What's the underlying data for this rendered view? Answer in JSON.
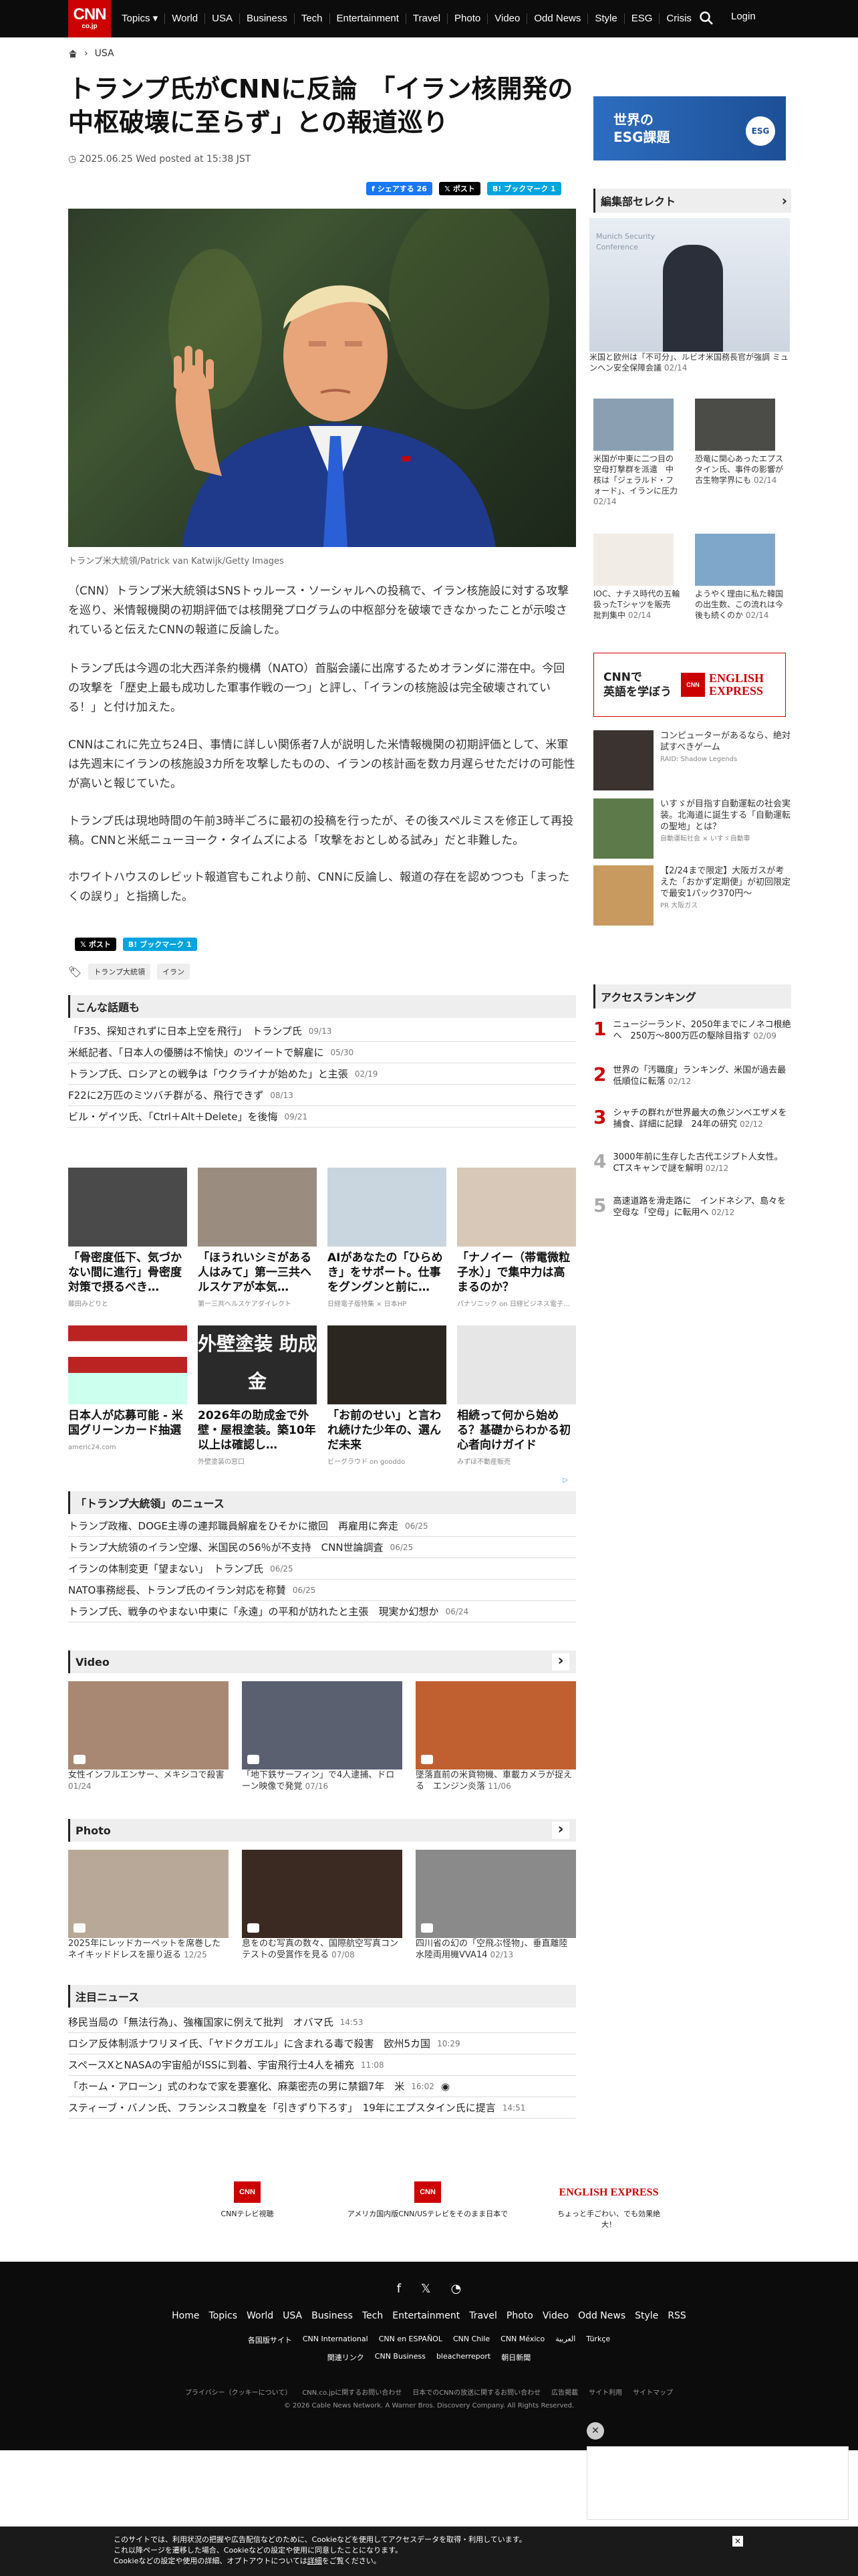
{
  "nav": {
    "logo_main": "CNN",
    "logo_sub": "co.jp",
    "items": [
      "Topics ▾",
      "World",
      "USA",
      "Business",
      "Tech",
      "Entertainment",
      "Travel",
      "Photo",
      "Video",
      "Odd News",
      "Style",
      "ESG",
      "Crisis"
    ],
    "login": "Login"
  },
  "breadcrumb": {
    "section": "USA"
  },
  "article": {
    "title": "トランプ氏がCNNに反論　「イラン核開発の中枢破壊に至らず」との報道巡り",
    "date": "2025.06.25 Wed posted at 15:38 JST",
    "share": {
      "facebook": "シェアする 26",
      "x": "ポスト",
      "hatena": "ブックマーク 1"
    },
    "caption": "トランプ米大統領/Patrick van Katwijk/Getty Images",
    "paragraphs": [
      "（CNN）トランプ米大統領はSNSトゥルース・ソーシャルへの投稿で、イラン核施設に対する攻撃を巡り、米情報機関の初期評価では核開発プログラムの中枢部分を破壊できなかったことが示唆されていると伝えたCNNの報道に反論した。",
      "トランプ氏は今週の北大西洋条約機構（NATO）首脳会議に出席するためオランダに滞在中。今回の攻撃を「歴史上最も成功した軍事作戦の一つ」と評し、「イランの核施設は完全破壊されている！」と付け加えた。",
      "CNNはこれに先立ち24日、事情に詳しい関係者7人が説明した米情報機関の初期評価として、米軍は先週末にイランの核施設3カ所を攻撃したものの、イランの核計画を数カ月遅らせただけの可能性が高いと報じていた。",
      "トランプ氏は現地時間の午前3時半ごろに最初の投稿を行ったが、その後スペルミスを修正して再投稿。CNNと米紙ニューヨーク・タイムズによる「攻撃をおとしめる試み」だと非難した。",
      "ホワイトハウスのレビット報道官もこれより前、CNNに反論し、報道の存在を認めつつも「まったくの誤り」と指摘した。"
    ],
    "bottom_share": {
      "x": "ポスト",
      "hatena": "ブックマーク 1"
    },
    "tags": [
      "トランプ大統領",
      "イラン"
    ]
  },
  "related": {
    "title": "こんな話題も",
    "items": [
      {
        "text": "「F35、探知されずに日本上空を飛行」　トランプ氏",
        "date": "09/13"
      },
      {
        "text": "米紙記者、「日本人の優勝は不愉快」のツイートで解雇に",
        "date": "05/30"
      },
      {
        "text": "トランプ氏、ロシアとの戦争は「ウクライナが始めた」と主張",
        "date": "02/19"
      },
      {
        "text": "F22に2万匹のミツバチ群がる、飛行できず",
        "date": "08/13"
      },
      {
        "text": "ビル・ゲイツ氏、「Ctrl＋Alt＋Delete」を後悔",
        "date": "09/21"
      }
    ]
  },
  "ads": [
    {
      "title": "「骨密度低下、気づかない間に進行」骨密度対策で摂るべき…",
      "src": "藤田みどりと"
    },
    {
      "title": "「ほうれいシミがある人はみて」第一三共ヘルスケアが本気…",
      "src": "第一三共ヘルスケアダイレクト"
    },
    {
      "title": "AIがあなたの「ひらめき」をサポート。仕事をグングンと前に…",
      "src": "日経電子版特集 × 日本HP"
    },
    {
      "title": "「ナノイー（帯電微粒子水）」で集中力は高まるのか？",
      "src": "パナソニック on 日経ビジネス電子…"
    },
    {
      "title": "日本人が応募可能 - 米国グリーンカード抽選",
      "src": "americ24.com"
    },
    {
      "title": "2026年の助成金で外壁・屋根塗装。築10年以上は確認し…",
      "src": "外壁塗装の窓口"
    },
    {
      "title": "「お前のせい」と言われ続けた少年の、選んだ未来",
      "src": "ビーグラウド on gooddo"
    },
    {
      "title": "相続って何から始める？基礎からわかる初心者向けガイド",
      "src": "みずほ不動産販売"
    }
  ],
  "ad_banner_text": "外壁塗装 助成金",
  "trump_news": {
    "title": "「トランプ大統領」のニュース",
    "items": [
      {
        "text": "トランプ政権、DOGE主導の連邦職員解雇をひそかに撤回　再雇用に奔走",
        "date": "06/25"
      },
      {
        "text": "トランプ大統領のイラン空爆、米国民の56％が不支持　CNN世論調査",
        "date": "06/25"
      },
      {
        "text": "イランの体制変更「望まない」　トランプ氏",
        "date": "06/25"
      },
      {
        "text": "NATO事務総長、トランプ氏のイラン対応を称賛",
        "date": "06/25"
      },
      {
        "text": "トランプ氏、戦争のやまない中東に「永遠」の平和が訪れたと主張　現実か幻想か",
        "date": "06/24"
      }
    ]
  },
  "video": {
    "title": "Video",
    "items": [
      {
        "text": "女性インフルエンサー、メキシコで殺害",
        "date": "01/24"
      },
      {
        "text": "「地下鉄サーフィン」で4人逮捕、ドローン映像で発覚",
        "date": "07/16"
      },
      {
        "text": "墜落直前の米貨物機、車載カメラが捉える　エンジン炎落",
        "date": "11/06"
      }
    ]
  },
  "photo": {
    "title": "Photo",
    "items": [
      {
        "text": "2025年にレッドカーペットを席巻したネイキッドドレスを振り返る",
        "date": "12/25"
      },
      {
        "text": "息をのむ写真の数々、国際航空写真コンテストの受賞作を見る",
        "date": "07/08"
      },
      {
        "text": "四川省の幻の「空飛ぶ怪物」、垂直離陸水陸両用機VVA14",
        "date": "02/13"
      }
    ]
  },
  "featured": {
    "title": "注目ニュース",
    "items": [
      {
        "text": "移民当局の「無法行為」、強権国家に例えて批判　オバマ氏",
        "date": "14:53"
      },
      {
        "text": "ロシア反体制派ナワリヌイ氏、「ヤドクガエル」に含まれる毒で殺害　欧州5カ国",
        "date": "10:29"
      },
      {
        "text": "スペースXとNASAの宇宙船がISSに到着、宇宙飛行士4人を補充",
        "date": "11:08"
      },
      {
        "text": "「ホーム・アローン」式のわなで家を要塞化、麻薬密売の男に禁錮7年　米",
        "date": "16:02"
      },
      {
        "text": "スティーブ・バノン氏、フランシスコ教皇を「引きずり下ろす」　19年にエプスタイン氏に提言",
        "date": "14:51"
      }
    ]
  },
  "promos": [
    {
      "logo": "CNN",
      "label": "CNNテレビ視聴"
    },
    {
      "logo": "CNN",
      "label": "アメリカ国内版CNN/USテレビをそのまま日本で"
    },
    {
      "logo": "ENGLISH EXPRESS",
      "label": "ちょっと手ごわい、でも効果絶大！"
    }
  ],
  "sidebar": {
    "esg_banner": {
      "line1": "世界の",
      "line2": "ESG課題",
      "badge": "ESG"
    },
    "editor_title": "編集部セレクト",
    "editor_main": {
      "text": "米国と欧州は「不可分」、ルビオ米国務長官が強調 ミュンヘン安全保障会議",
      "date": "02/14",
      "scene": "Munich Security Conference"
    },
    "editor_items": [
      {
        "text": "米国が中東に二つ目の空母打撃群を派遣　中核は「ジェラルド・フォード」、イランに圧力",
        "date": "02/14"
      },
      {
        "text": "恐竜に関心あったエプスタイン氏、事件の影響が古生物学界にも",
        "date": "02/14"
      },
      {
        "text": "IOC、ナチス時代の五輪扱ったTシャツを販売　批判集中",
        "date": "02/14"
      },
      {
        "text": "ようやく理由に私た韓国の出生数、この流れは今後も続くのか",
        "date": "02/14"
      }
    ],
    "english_banner": {
      "left1": "CNNで",
      "left2": "英語を学ぼう",
      "logo1": "ENGLISH",
      "logo2": "EXPRESS"
    },
    "ad_items": [
      {
        "text": "コンピューターがあるなら、絶対試すべきゲーム",
        "src": "RAID: Shadow Legends"
      },
      {
        "text": "いすゞが目指す自動運転の社会実装。北海道に誕生する「自動運転の聖地」とは？",
        "src": "自動運転社会 × いすゞ自動車"
      },
      {
        "text": "【2/24まで限定】大阪ガスが考えた「おかず定期便」が初回限定で最安1パック370円〜",
        "src": "PR 大阪ガス"
      }
    ],
    "ranking_title": "アクセスランキング",
    "ranking": [
      {
        "n": "1",
        "text": "ニュージーランド、2050年までにノネコ根絶へ　250万〜800万匹の駆除目指す",
        "date": "02/09"
      },
      {
        "n": "2",
        "text": "世界の「汚職度」ランキング、米国が過去最低順位に転落",
        "date": "02/12"
      },
      {
        "n": "3",
        "text": "シャチの群れが世界最大の魚ジンベエザメを捕食、詳細に記録　24年の研究",
        "date": "02/12"
      },
      {
        "n": "4",
        "text": "3000年前に生存した古代エジプト人女性。CTスキャンで謎を解明",
        "date": "02/12"
      },
      {
        "n": "5",
        "text": "高速道路を滑走路に　インドネシア、島々を空母な「空母」に転用へ",
        "date": "02/12"
      }
    ]
  },
  "footer": {
    "links": [
      "Home",
      "Topics",
      "World",
      "USA",
      "Business",
      "Tech",
      "Entertainment",
      "Travel",
      "Photo",
      "Video",
      "Odd News",
      "Style",
      "RSS"
    ],
    "sublinks1": [
      "各国版サイト",
      "CNN International",
      "CNN en ESPAÑOL",
      "CNN Chile",
      "CNN México",
      "العربية",
      "Türkçe"
    ],
    "sublinks2": [
      "関連リンク",
      "CNN Business",
      "bleacherreport",
      "朝日新聞"
    ],
    "policy": [
      "プライバシー（クッキーについて）",
      "CNN.co.jpに関するお問い合わせ",
      "日本でのCNNの放送に関するお問い合わせ",
      "広告掲載",
      "サイト利用",
      "サイトマップ"
    ],
    "copyright": "© 2026 Cable News Network. A Warner Bros. Discovery Company. All Rights Reserved."
  },
  "cookie": {
    "line1": "このサイトでは、利用状況の把握や広告配信などのために、Cookieなどを使用してアクセスデータを取得・利用しています。",
    "line2": "これ以降ページを遷移した場合、Cookieなどの設定や使用に同意したことになります。",
    "line3": "Cookieなどの設定や使用の詳細、オプトアウトについては",
    "link": "詳細",
    "line3b": "をご覧ください。"
  },
  "colors": {
    "brand": "#cc0000",
    "nav_bg": "#0c0c0c"
  }
}
